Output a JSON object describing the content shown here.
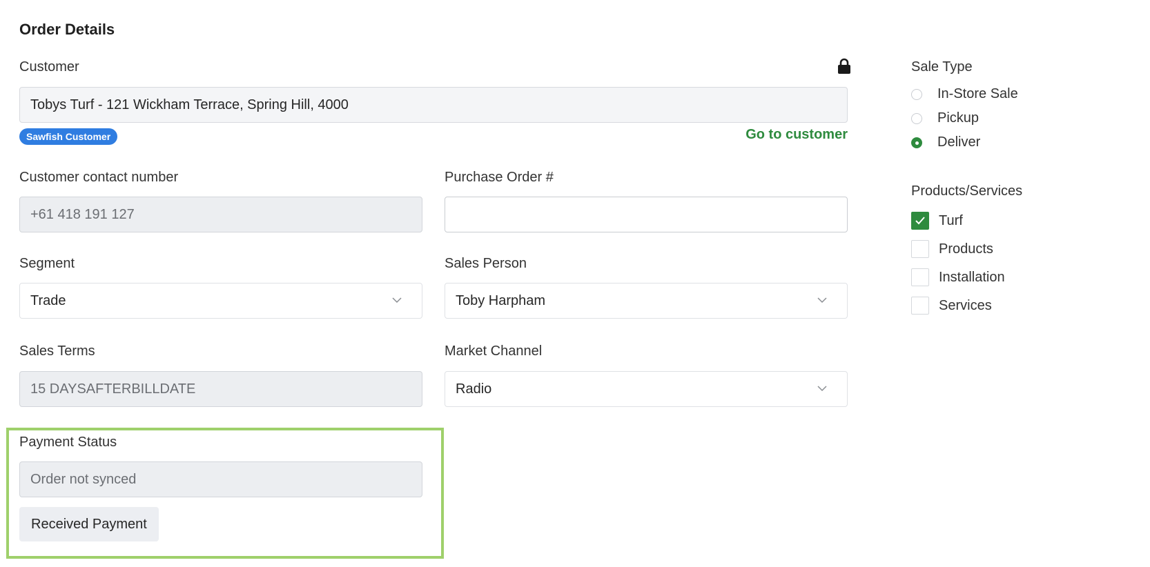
{
  "title": "Order Details",
  "customer": {
    "label": "Customer",
    "value": "Tobys Turf - 121 Wickham Terrace, Spring Hill, 4000",
    "badge": "Sawfish Customer",
    "link": "Go to customer"
  },
  "contact": {
    "label": "Customer contact number",
    "value": "+61 418 191 127"
  },
  "purchase_order": {
    "label": "Purchase Order #",
    "value": ""
  },
  "segment": {
    "label": "Segment",
    "value": "Trade"
  },
  "sales_person": {
    "label": "Sales Person",
    "value": "Toby Harpham"
  },
  "sales_terms": {
    "label": "Sales Terms",
    "value": "15 DAYSAFTERBILLDATE"
  },
  "market_channel": {
    "label": "Market Channel",
    "value": "Radio"
  },
  "payment": {
    "label": "Payment Status",
    "value": "Order not synced",
    "button": "Received Payment"
  },
  "sale_type": {
    "label": "Sale Type",
    "options": [
      "In-Store Sale",
      "Pickup",
      "Deliver"
    ],
    "selected": "Deliver"
  },
  "products": {
    "label": "Products/Services",
    "items": [
      {
        "label": "Turf",
        "checked": true
      },
      {
        "label": "Products",
        "checked": false
      },
      {
        "label": "Installation",
        "checked": false
      },
      {
        "label": "Services",
        "checked": false
      }
    ]
  },
  "colors": {
    "accent": "#2e8b3e",
    "badge": "#2f7de1",
    "highlight": "#9fd06b"
  },
  "icons": [
    "lock-icon",
    "chevron-down-icon",
    "check-icon"
  ]
}
